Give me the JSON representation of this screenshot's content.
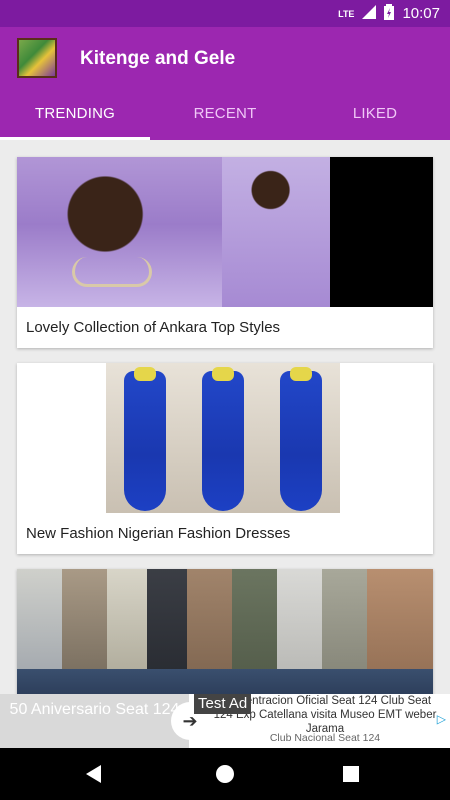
{
  "status_bar": {
    "network": "LTE",
    "time": "10:07"
  },
  "app_bar": {
    "title": "Kitenge and Gele"
  },
  "tabs": [
    {
      "label": "TRENDING",
      "active": true
    },
    {
      "label": "RECENT",
      "active": false
    },
    {
      "label": "LIKED",
      "active": false
    }
  ],
  "cards": [
    {
      "caption": "Lovely Collection of Ankara Top Styles"
    },
    {
      "caption": "New Fashion   Nigerian Fashion Dresses"
    },
    {
      "caption": ""
    }
  ],
  "ad": {
    "left_text": "50 Aniversario Seat 124",
    "badge": "Test Ad",
    "text": "Concentracion Oficial Seat 124 Club Seat 124 Exp Catellana visita Museo EMT weber Jarama",
    "sub_text": "Club Nacional Seat 124"
  },
  "colors": {
    "app_bar": "#9c27b0",
    "status_bar": "#7d1ba0"
  }
}
